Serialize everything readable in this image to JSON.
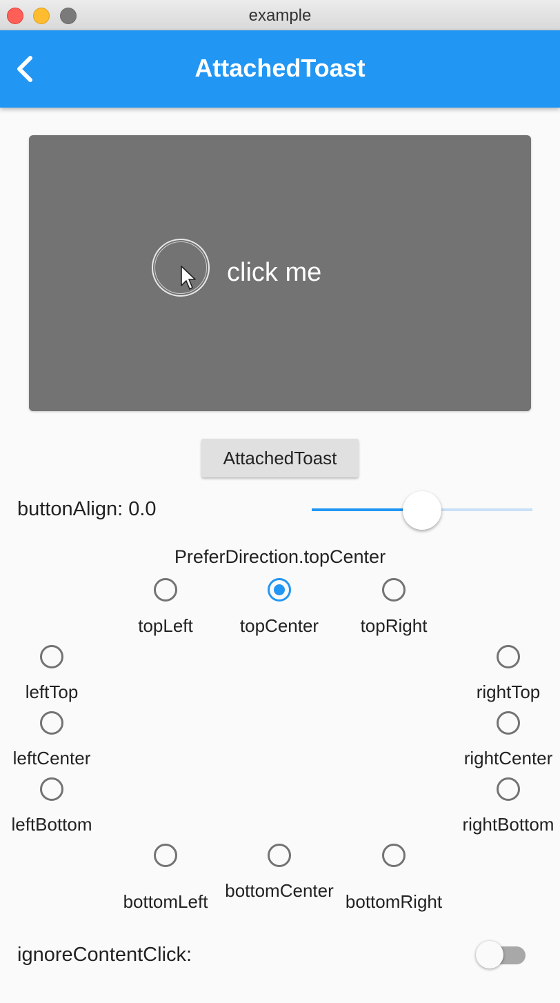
{
  "window": {
    "title": "example"
  },
  "appbar": {
    "title": "AttachedToast"
  },
  "content_box": {
    "label": "click me"
  },
  "button": {
    "label": "AttachedToast"
  },
  "slider": {
    "label": "buttonAlign: 0.0",
    "value": 0.5
  },
  "direction": {
    "title": "PreferDirection.topCenter",
    "selected": "topCenter",
    "options": {
      "topLeft": "topLeft",
      "topCenter": "topCenter",
      "topRight": "topRight",
      "leftTop": "leftTop",
      "leftCenter": "leftCenter",
      "leftBottom": "leftBottom",
      "rightTop": "rightTop",
      "rightCenter": "rightCenter",
      "rightBottom": "rightBottom",
      "bottomLeft": "bottomLeft",
      "bottomCenter": "bottomCenter",
      "bottomRight": "bottomRight"
    }
  },
  "ignore_content_click": {
    "label": "ignoreContentClick:",
    "enabled": false
  },
  "colors": {
    "primary": "#2196f3",
    "content_box": "#737373",
    "background": "#fafafa"
  }
}
